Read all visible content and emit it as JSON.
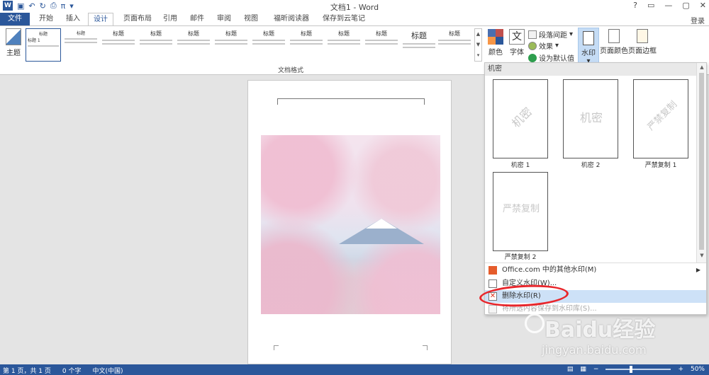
{
  "window": {
    "title": "文档1 - Word",
    "controls": [
      "?",
      "▭",
      "—",
      "▢",
      "✕"
    ],
    "signin": "登录"
  },
  "quick_access": [
    "save-icon",
    "undo-icon",
    "redo-icon",
    "print-preview-icon",
    "equation-icon"
  ],
  "tabs": [
    "文件",
    "开始",
    "插入",
    "设计",
    "页面布局",
    "引用",
    "邮件",
    "审阅",
    "视图",
    "福昕阅读器",
    "保存到云笔记"
  ],
  "active_tab": "设计",
  "ribbon": {
    "theme_label": "主题",
    "style_thumbs": [
      "标题",
      "标题",
      "标题",
      "标题",
      "标题",
      "标题",
      "标题",
      "标题",
      "标题",
      "标题",
      "标题",
      "标题"
    ],
    "first_thumb_heading": "标题 1",
    "group_label": "文档格式",
    "colors_label": "颜色",
    "fonts_label": "字体",
    "paragraph_spacing": "段落间距",
    "effects": "效果",
    "set_default": "设为默认值",
    "watermark": "水印",
    "page_color": "页面颜色",
    "page_borders": "页面边框"
  },
  "dropdown": {
    "header": "机密",
    "tiles": [
      {
        "text": "机密",
        "caption": "机密 1",
        "style": "diagonal"
      },
      {
        "text": "机密",
        "caption": "机密 2",
        "style": "horizontal"
      },
      {
        "text": "严禁复制",
        "caption": "严禁复制 1",
        "style": "diagonal"
      },
      {
        "text": "严禁复制",
        "caption": "严禁复制 2",
        "style": "horizontal"
      }
    ],
    "menu": [
      {
        "label": "Office.com 中的其他水印(M)",
        "submenu": true
      },
      {
        "label": "自定义水印(W)...",
        "submenu": false
      },
      {
        "label": "删除水印(R)",
        "submenu": false,
        "highlighted": true
      },
      {
        "label": "将所选内容保存到水印库(S)...",
        "submenu": false,
        "disabled": true
      }
    ]
  },
  "status": {
    "page": "第 1 页，共 1 页",
    "words": "0 个字",
    "language": "中文(中国)",
    "zoom": "50%"
  },
  "overlay": {
    "brand": "Baidu经验",
    "url": "jingyan.baidu.com"
  },
  "colors": {
    "accent": "#2b579a",
    "highlight": "#cde1f7",
    "annotation": "#e8262b"
  }
}
